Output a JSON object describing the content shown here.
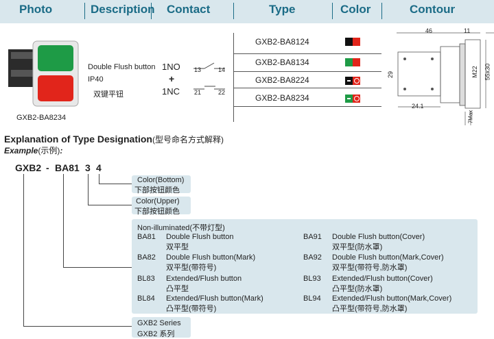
{
  "header": {
    "photo": "Photo",
    "description": "Description",
    "contact": "Contact",
    "type": "Type",
    "color": "Color",
    "contour": "Contour"
  },
  "product": {
    "photo_caption": "GXB2-BA8234",
    "desc_line1": "Double Flush button",
    "desc_line2": "IP40",
    "desc_line3": "双键平钮",
    "contact_no": "1NO",
    "contact_plus": "+",
    "contact_nc": "1NC",
    "no_t1": "13",
    "no_t2": "14",
    "nc_t1": "21",
    "nc_t2": "22",
    "types": [
      "GXB2-BA8124",
      "GXB2-BA8134",
      "GXB2-BA8224",
      "GXB2-BA8234"
    ],
    "colors": [
      [
        "#111111",
        "#e1251b"
      ],
      [
        "#1e9b46",
        "#e1251b"
      ],
      [
        "#111111",
        "#e1251b"
      ],
      [
        "#1e9b46",
        "#e1251b"
      ]
    ]
  },
  "contour": {
    "d46": "46",
    "d11": "11",
    "d29": "29",
    "m22": "M22",
    "d55": "55x30",
    "d241": "24.1",
    "d7": "7Max"
  },
  "explanation": {
    "title": "Explanation of Type Designation",
    "title_cn": "(型号命名方式解释)",
    "example": "Example",
    "example_cn": "(示例)",
    "colon": ":",
    "code_series": "GXB2",
    "code_dash": "-",
    "code_ba": "BA81",
    "code_3": "3",
    "code_4": "4",
    "color_bottom": "Color(Bottom)",
    "color_bottom_cn": "下部按钮颜色",
    "color_upper": "Color(Upper)",
    "color_upper_cn": "下部按钮颜色",
    "nonillum": "Non-illuminated",
    "nonillum_cn": "(不带灯型)",
    "left_items": [
      {
        "code": "BA81",
        "en": "Double Flush button",
        "cn": "双平型"
      },
      {
        "code": "BA82",
        "en": "Double Flush button(Mark)",
        "cn": "双平型(带符号)"
      },
      {
        "code": "BL83",
        "en": "Extended/Flush button",
        "cn": "凸平型"
      },
      {
        "code": "BL84",
        "en": "Extended/Flush button(Mark)",
        "cn": "凸平型(带符号)"
      }
    ],
    "right_items": [
      {
        "code": "BA91",
        "en": "Double Flush button(Cover)",
        "cn": "双平型(防水罩)"
      },
      {
        "code": "BA92",
        "en": "Double Flush button(Mark,Cover)",
        "cn": "双平型(带符号,防水罩)"
      },
      {
        "code": "BL93",
        "en": "Extended/Flush button(Cover)",
        "cn": "凸平型(防水罩)"
      },
      {
        "code": "BL94",
        "en": "Extended/Flush button(Mark,Cover)",
        "cn": "凸平型(带符号,防水罩)"
      }
    ],
    "series": "GXB2 Series",
    "series_cn": "GXB2 系列"
  }
}
